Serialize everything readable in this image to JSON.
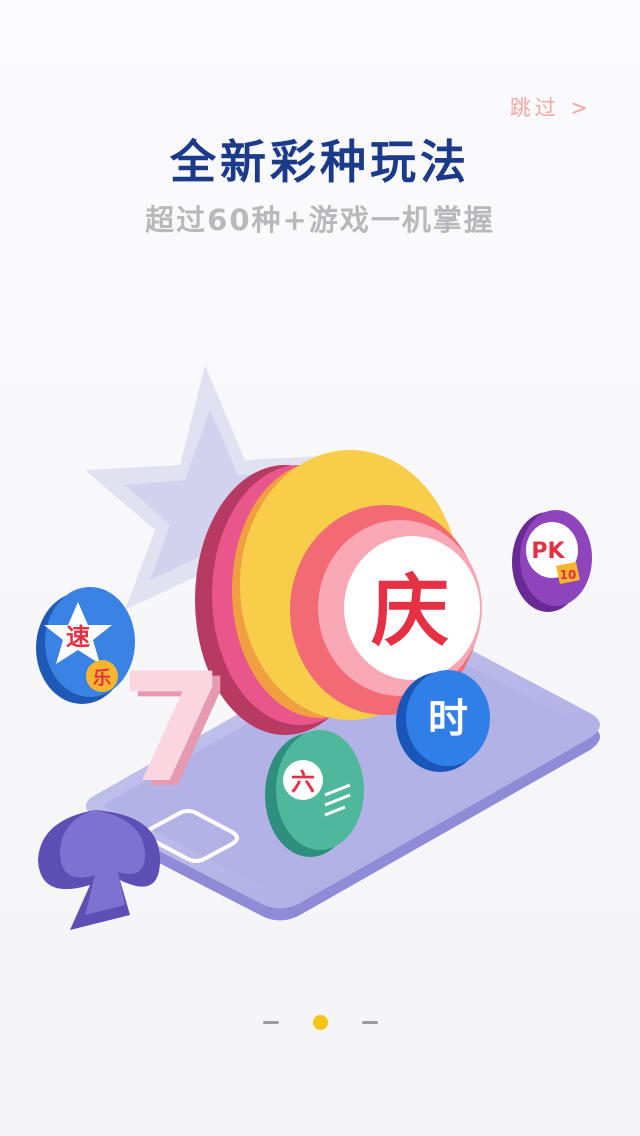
{
  "header": {
    "skip_label": "跳过 >",
    "title": "全新彩种玩法",
    "subtitle": "超过60种+游戏一机掌握"
  },
  "illustration": {
    "coin_main": "庆",
    "coin_blue": "时",
    "coin_green": "六",
    "coin_left_top": "速",
    "coin_left_bottom": "乐",
    "coin_right_top": "PK",
    "coin_right_bottom": "10",
    "slot_seven": "7"
  },
  "pager": {
    "total": 3,
    "active_index": 1
  },
  "colors": {
    "title": "#1b3a8a",
    "subtitle": "#b8b8bd",
    "skip": "#f4a7a0",
    "active_dot": "#f6c317"
  }
}
